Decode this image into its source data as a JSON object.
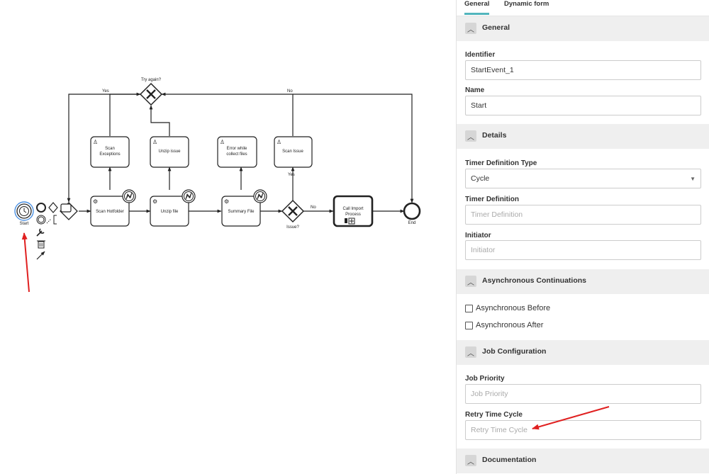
{
  "diagram": {
    "start_label": "Start",
    "end_label": "End",
    "gateway_try_again": "Try again?",
    "gateway_issue": "Issue?",
    "flow_yes_top": "Yes",
    "flow_no_top": "No",
    "flow_no_mid": "No",
    "flow_yes_mid": "Yes",
    "tasks": {
      "scan_hotfolder": [
        "Scan Hotfolder"
      ],
      "unzip_file": [
        "Unzip file"
      ],
      "summary_file": [
        "Summary File"
      ],
      "call_import": [
        "Call Import",
        "Process"
      ],
      "scan_exceptions": [
        "Scan",
        "Exceptions"
      ],
      "unzip_issue": [
        "Unzip issue"
      ],
      "error_collect": [
        "Error while",
        "collect files"
      ],
      "scan_issue": [
        "Scan Issue"
      ]
    },
    "annotation_color": "#e02020",
    "selection_color": "#4a90e2"
  },
  "panel": {
    "tabs": [
      "General",
      "Dynamic form"
    ],
    "active_tab": "General",
    "groups": {
      "general": "General",
      "details": "Details",
      "async": "Asynchronous Continuations",
      "job": "Job Configuration",
      "documentation": "Documentation"
    },
    "fields": {
      "identifier": {
        "label": "Identifier",
        "value": "StartEvent_1"
      },
      "name": {
        "label": "Name",
        "value": "Start"
      },
      "timer_type": {
        "label": "Timer Definition Type",
        "value": "Cycle"
      },
      "timer_definition": {
        "label": "Timer Definition",
        "placeholder": "Timer Definition"
      },
      "initiator": {
        "label": "Initiator",
        "placeholder": "Initiator"
      },
      "job_priority": {
        "label": "Job Priority",
        "placeholder": "Job Priority"
      },
      "retry_time_cycle": {
        "label": "Retry Time Cycle",
        "placeholder": "Retry Time Cycle"
      }
    },
    "checkboxes": {
      "async_before": "Asynchronous Before",
      "async_after": "Asynchronous After"
    },
    "accent_color": "#52b5bd"
  }
}
